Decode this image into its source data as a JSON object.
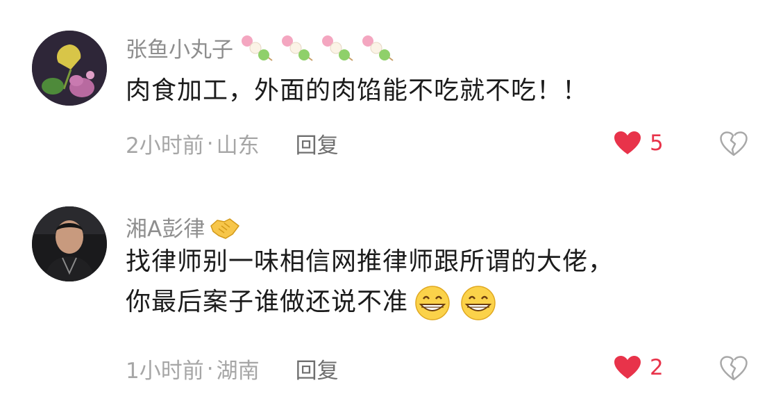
{
  "comments": [
    {
      "avatar_icon": "ginkgo-flower-avatar",
      "username": "张鱼小丸子",
      "username_decoration": "dango-emoji",
      "text_lines": [
        "肉食加工，外面的肉馅能不吃就不吃！！"
      ],
      "time": "2小时前",
      "separator": "·",
      "location": "山东",
      "reply_label": "回复",
      "like_count": "5",
      "colors": {
        "like": "#e8334a",
        "meta": "#a6a6a6"
      }
    },
    {
      "avatar_icon": "man-portrait-avatar",
      "username": "湘A彭律",
      "username_decoration": "handshake-emoji",
      "text_lines": [
        "找律师别一味相信网推律师跟所谓的大佬，",
        "你最后案子谁做还说不准"
      ],
      "text_trailing_emoji": "grinning-face-emoji",
      "time": "1小时前",
      "separator": "·",
      "location": "湖南",
      "reply_label": "回复",
      "like_count": "2",
      "colors": {
        "like": "#e8334a",
        "meta": "#a6a6a6"
      }
    }
  ]
}
